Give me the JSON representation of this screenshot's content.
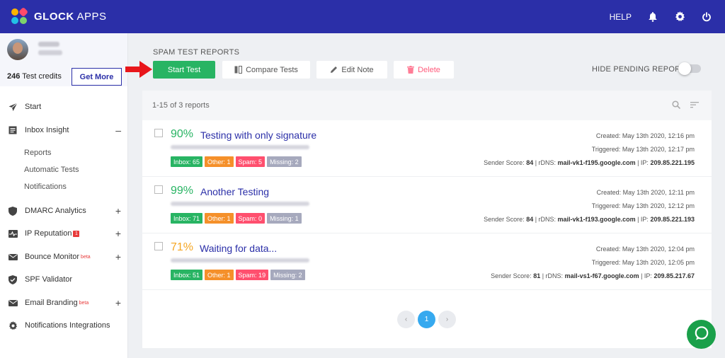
{
  "header": {
    "logo_bold": "GLOCK",
    "logo_light": " APPS",
    "help": "HELP",
    "icons": [
      "bell-icon",
      "gear-icon",
      "power-icon"
    ],
    "bar_color": "#2b2fa8"
  },
  "sidebar": {
    "credits_count": "246",
    "credits_label": " Test credits",
    "get_more": "Get More",
    "items": [
      {
        "label": "Start",
        "icon": "paper-plane-icon"
      },
      {
        "label": "Inbox Insight",
        "icon": "inbox-insight-icon",
        "toggle": "–"
      },
      {
        "label": "DMARC Analytics",
        "icon": "shield-icon",
        "toggle": "+"
      },
      {
        "label": "IP Reputation",
        "icon": "pulse-icon",
        "toggle": "+",
        "badge": "1"
      },
      {
        "label": "Bounce Monitor",
        "icon": "envelope-icon",
        "toggle": "+",
        "sup": "beta"
      },
      {
        "label": "SPF Validator",
        "icon": "check-shield-icon"
      },
      {
        "label": "Email Branding",
        "icon": "mail-icon",
        "toggle": "+",
        "sup": "beta"
      },
      {
        "label": "Notifications Integrations",
        "icon": "gear-icon"
      }
    ],
    "subitems": [
      "Reports",
      "Automatic Tests",
      "Notifications"
    ]
  },
  "main": {
    "section_title": "SPAM TEST REPORTS",
    "buttons": {
      "start": "Start Test",
      "compare": "Compare Tests",
      "edit": "Edit Note",
      "delete": "Delete"
    },
    "hide_pending": "HIDE PENDING REPORTS",
    "hide_pending_on": false,
    "count": "1-15 of 3 reports",
    "reports": [
      {
        "score": "90%",
        "score_color": "#28b463",
        "title": "Testing with only signature",
        "tags": {
          "inbox": "Inbox: 65",
          "other": "Other: 1",
          "spam": "Spam: 5",
          "missing": "Missing: 2"
        },
        "created": "Created: May 13th 2020, 12:16 pm",
        "triggered": "Triggered: May 13th 2020, 12:17 pm",
        "sender_score_label": "Sender Score: ",
        "sender_score": "84",
        "rdns_label": " | rDNS: ",
        "rdns": "mail-vk1-f195.google.com",
        "ip_label": " | IP: ",
        "ip": "209.85.221.195"
      },
      {
        "score": "99%",
        "score_color": "#28b463",
        "title": "Another Testing",
        "tags": {
          "inbox": "Inbox: 71",
          "other": "Other: 1",
          "spam": "Spam: 0",
          "missing": "Missing: 1"
        },
        "created": "Created: May 13th 2020, 12:11 pm",
        "triggered": "Triggered: May 13th 2020, 12:12 pm",
        "sender_score_label": "Sender Score: ",
        "sender_score": "84",
        "rdns_label": " | rDNS: ",
        "rdns": "mail-vk1-f193.google.com",
        "ip_label": " | IP: ",
        "ip": "209.85.221.193"
      },
      {
        "score": "71%",
        "score_color": "#f5a623",
        "title": "Waiting for data...",
        "tags": {
          "inbox": "Inbox: 51",
          "other": "Other: 1",
          "spam": "Spam: 19",
          "missing": "Missing: 2"
        },
        "created": "Created: May 13th 2020, 12:04 pm",
        "triggered": "Triggered: May 13th 2020, 12:05 pm",
        "sender_score_label": "Sender Score: ",
        "sender_score": "81",
        "rdns_label": " | rDNS: ",
        "rdns": "mail-vs1-f67.google.com",
        "ip_label": " | IP: ",
        "ip": "209.85.217.67"
      }
    ],
    "pagination": {
      "current": "1",
      "prev": "‹",
      "next": "›"
    }
  }
}
